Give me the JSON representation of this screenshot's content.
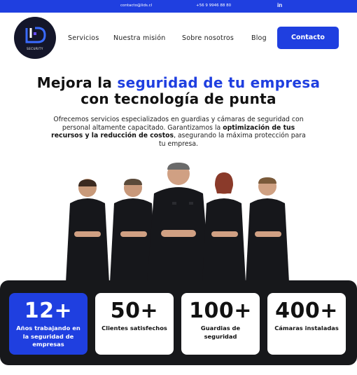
{
  "topbar": {
    "email": "contacto@lids.cl",
    "phone": "+56 9 9946 88 80",
    "social_icon": "linkedin-icon",
    "social_label": "in"
  },
  "header": {
    "logo_subtext": "SECURITY",
    "nav": [
      "Servicios",
      "Nuestra misión",
      "Sobre nosotros",
      "Blog"
    ],
    "cta_label": "Contacto"
  },
  "hero": {
    "title_line1_plain": "Mejora la ",
    "title_line1_highlight": "seguridad de tu empresa",
    "title_line2": "con tecnología de punta",
    "desc_part1": "Ofrecemos servicios especializados en guardias y cámaras de seguridad con personal altamente capacitado. Garantizamos la ",
    "desc_bold": "optimización de tus recursos y la reducción de costos",
    "desc_part2": ", asegurando la máxima protección para tu empresa."
  },
  "stats": [
    {
      "value": "12+",
      "label": "Años trabajando en la seguridad de empresas",
      "highlight": true
    },
    {
      "value": "50+",
      "label": "Clientes satisfechos",
      "highlight": false
    },
    {
      "value": "100+",
      "label": "Guardias de seguridad",
      "highlight": false
    },
    {
      "value": "400+",
      "label": "Cámaras instaladas",
      "highlight": false
    }
  ],
  "colors": {
    "brand_blue": "#1f3fe0",
    "dark_panel": "#17181b",
    "uniform": "#16171b"
  }
}
